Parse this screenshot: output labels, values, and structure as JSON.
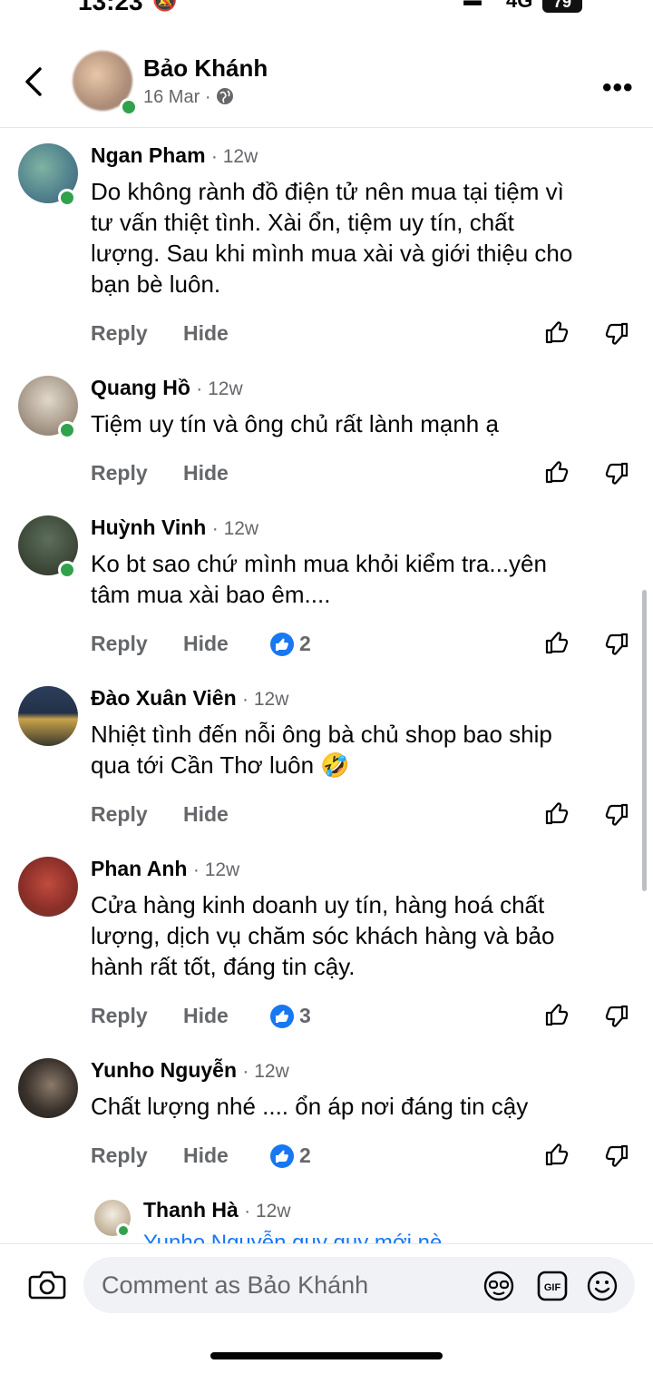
{
  "status_bar": {
    "time": "13:23",
    "network": "4G",
    "battery": "79"
  },
  "header": {
    "title": "Bảo Khánh",
    "date": "16 Mar",
    "separator": "·",
    "more_label": "•••"
  },
  "actions": {
    "reply": "Reply",
    "hide": "Hide"
  },
  "comments": [
    {
      "name": "Ngan Pham",
      "age": "· 12w",
      "lines": [
        "Do không rành đồ điện tử nên mua tại tiệm vì",
        "tư vấn thiệt tình. Xài ổn, tiệm uy tín, chất",
        "lượng. Sau khi mình mua xài và giới thiệu cho",
        "bạn bè luôn."
      ],
      "reactions": null
    },
    {
      "name": "Quang Hồ",
      "age": "· 12w",
      "lines": [
        "Tiệm uy tín và ông chủ rất lành mạnh ạ"
      ],
      "reactions": null
    },
    {
      "name": "Huỳnh Vinh",
      "age": "· 12w",
      "lines": [
        "Ko bt sao chứ mình mua khỏi kiểm tra...yên",
        "tâm mua xài bao êm...."
      ],
      "reactions": "2"
    },
    {
      "name": "Đào Xuân Viên",
      "age": "· 12w",
      "lines": [
        "Nhiệt tình đến nỗi ông bà chủ shop bao ship",
        "qua tới Cần Thơ luôn 🤣"
      ],
      "reactions": null
    },
    {
      "name": "Phan Anh",
      "age": "· 12w",
      "lines": [
        "Cửa hàng kinh doanh uy tín, hàng hoá chất",
        "lượng, dịch vụ chăm sóc khách hàng và bảo",
        "hành rất tốt, đáng tin cậy."
      ],
      "reactions": "3"
    },
    {
      "name": "Yunho Nguyễn",
      "age": "· 12w",
      "lines": [
        "Chất lượng nhé .... ổn áp nơi đáng tin cậy"
      ],
      "reactions": "2"
    }
  ],
  "reply": {
    "name": "Thanh Hà",
    "age": "· 12w",
    "text": "Yunho Nguyễn quy quy mới nè"
  },
  "composer": {
    "placeholder": "Comment as Bảo Khánh"
  }
}
